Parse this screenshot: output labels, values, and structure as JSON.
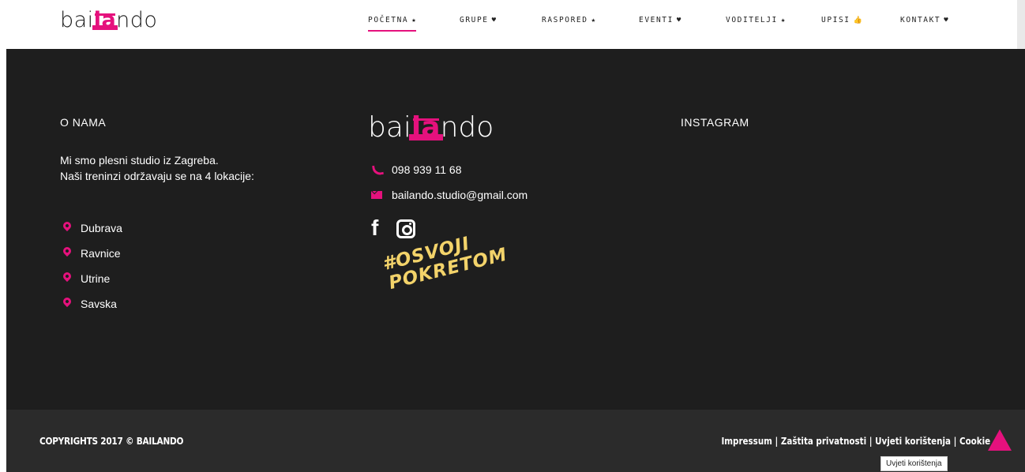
{
  "header": {
    "logo": {
      "part1": "bai",
      "part2": "la",
      "part3": "ndo"
    },
    "nav": [
      {
        "label": "POČETNA",
        "icon": "★",
        "icon_name": "star-icon",
        "active": true
      },
      {
        "label": "GRUPE",
        "icon": "♥",
        "icon_name": "heart-icon",
        "active": false
      },
      {
        "label": "RASPORED",
        "icon": "★",
        "icon_name": "star-icon",
        "active": false
      },
      {
        "label": "EVENTI",
        "icon": "♥",
        "icon_name": "heart-icon",
        "active": false
      },
      {
        "label": "VODITELJI",
        "icon": "★",
        "icon_name": "star-icon",
        "active": false
      },
      {
        "label": "UPISI",
        "icon": "👍",
        "icon_name": "thumbs-up-icon",
        "active": false
      },
      {
        "label": "KONTAKT",
        "icon": "♥",
        "icon_name": "heart-icon",
        "active": false
      }
    ]
  },
  "about": {
    "title": "O NAMA",
    "line1": "Mi smo plesni studio iz Zagreba.",
    "line2": "Naši treninzi održavaju se na 4 lokacije:",
    "locations": [
      "Dubrava",
      "Ravnice",
      "Utrine",
      "Savska"
    ]
  },
  "contact": {
    "logo": {
      "part1": "bai",
      "part2": "la",
      "part3": "ndo"
    },
    "phone": "098 939 11 68",
    "email": "bailando.studio@gmail.com",
    "slogan_line1": "#OSVOJI",
    "slogan_line2": "POKRETOM"
  },
  "instagram": {
    "title": "INSTAGRAM"
  },
  "footer": {
    "copyright": "COPYRIGHTS 2017 © BAILANDO",
    "links": [
      "Impressum",
      "Zaštita privatnosti",
      "Uvjeti korištenja",
      "Cookie"
    ],
    "separator": " | ",
    "tooltip": "Uvjeti korištenja"
  },
  "colors": {
    "accent": "#e5117d",
    "dark": "#1e1e1e",
    "footer": "#2b2b2b",
    "slogan": "#f3d36a"
  }
}
